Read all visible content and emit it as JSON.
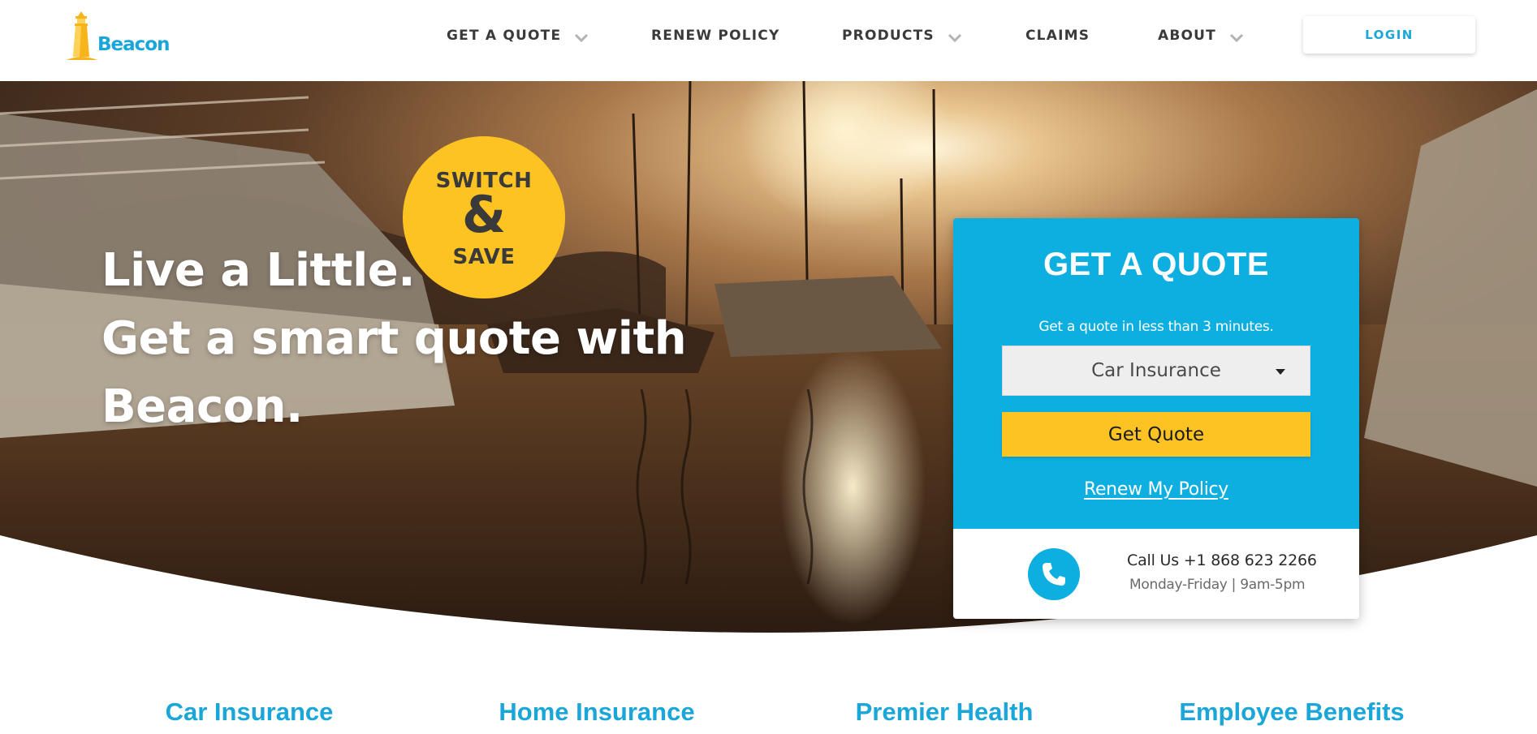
{
  "brand": {
    "name": "Beacon",
    "logo_icon": "lighthouse-icon",
    "color": "#1aa6d8",
    "accent": "#fdc322"
  },
  "nav": {
    "items": [
      {
        "label": "GET A QUOTE",
        "dropdown": true
      },
      {
        "label": "RENEW POLICY",
        "dropdown": false
      },
      {
        "label": "PRODUCTS",
        "dropdown": true
      },
      {
        "label": "CLAIMS",
        "dropdown": false
      },
      {
        "label": "ABOUT",
        "dropdown": true
      }
    ],
    "login_label": "LOGIN"
  },
  "hero": {
    "lines": [
      "Live a Little.",
      "Get a smart quote with",
      "Beacon."
    ],
    "badge": {
      "top": "SWITCH",
      "middle": "&",
      "bottom": "SAVE"
    }
  },
  "quote_card": {
    "title": "GET A QUOTE",
    "subtitle": "Get a quote in less than 3 minutes.",
    "selected_product": "Car Insurance",
    "button_label": "Get Quote",
    "renew_link": "Renew My Policy",
    "call_text": "Call Us +1 868 623 2266",
    "hours_text": "Monday-Friday | 9am-5pm",
    "phone_icon": "phone-icon",
    "color": "#0daee0"
  },
  "products": [
    "Car Insurance",
    "Home Insurance",
    "Premier Health",
    "Employee Benefits"
  ]
}
